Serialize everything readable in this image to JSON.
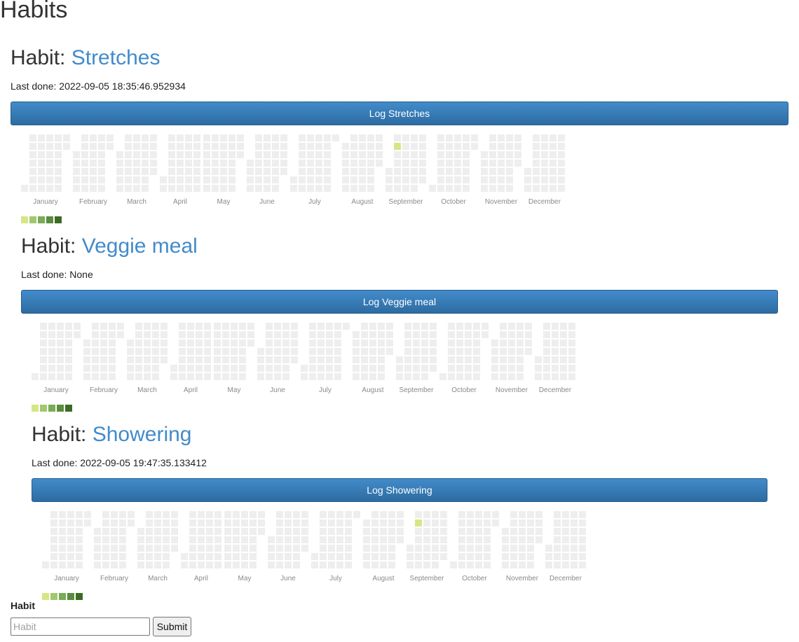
{
  "page": {
    "title": "Habits"
  },
  "habit_prefix": "Habit: ",
  "last_done_prefix": "Last done: ",
  "log_prefix": "Log ",
  "months": [
    "January",
    "February",
    "March",
    "April",
    "May",
    "June",
    "July",
    "August",
    "September",
    "October",
    "November",
    "December"
  ],
  "year": 2022,
  "colors": {
    "empty": "#eeeeee",
    "scale": [
      "#d6e685",
      "#8cc665",
      "#6ba34a",
      "#44a340",
      "#3f6b28"
    ],
    "legend": [
      "#d6e685",
      "#a2c86f",
      "#7aab55",
      "#5a8c3e",
      "#3c6b25"
    ],
    "button": "#428bca"
  },
  "habits": [
    {
      "name": "Stretches",
      "last_done": "2022-09-05 18:35:46.952934",
      "button_label": "Log Stretches",
      "logged_dates": [
        "2022-09-05"
      ]
    },
    {
      "name": "Veggie meal",
      "last_done": "None",
      "button_label": "Log Veggie meal",
      "logged_dates": []
    },
    {
      "name": "Showering",
      "last_done": "2022-09-05 19:47:35.133412",
      "button_label": "Log Showering",
      "logged_dates": [
        "2022-09-05"
      ]
    }
  ],
  "form": {
    "label": "Habit",
    "placeholder": "Habit",
    "submit_label": "Submit"
  }
}
